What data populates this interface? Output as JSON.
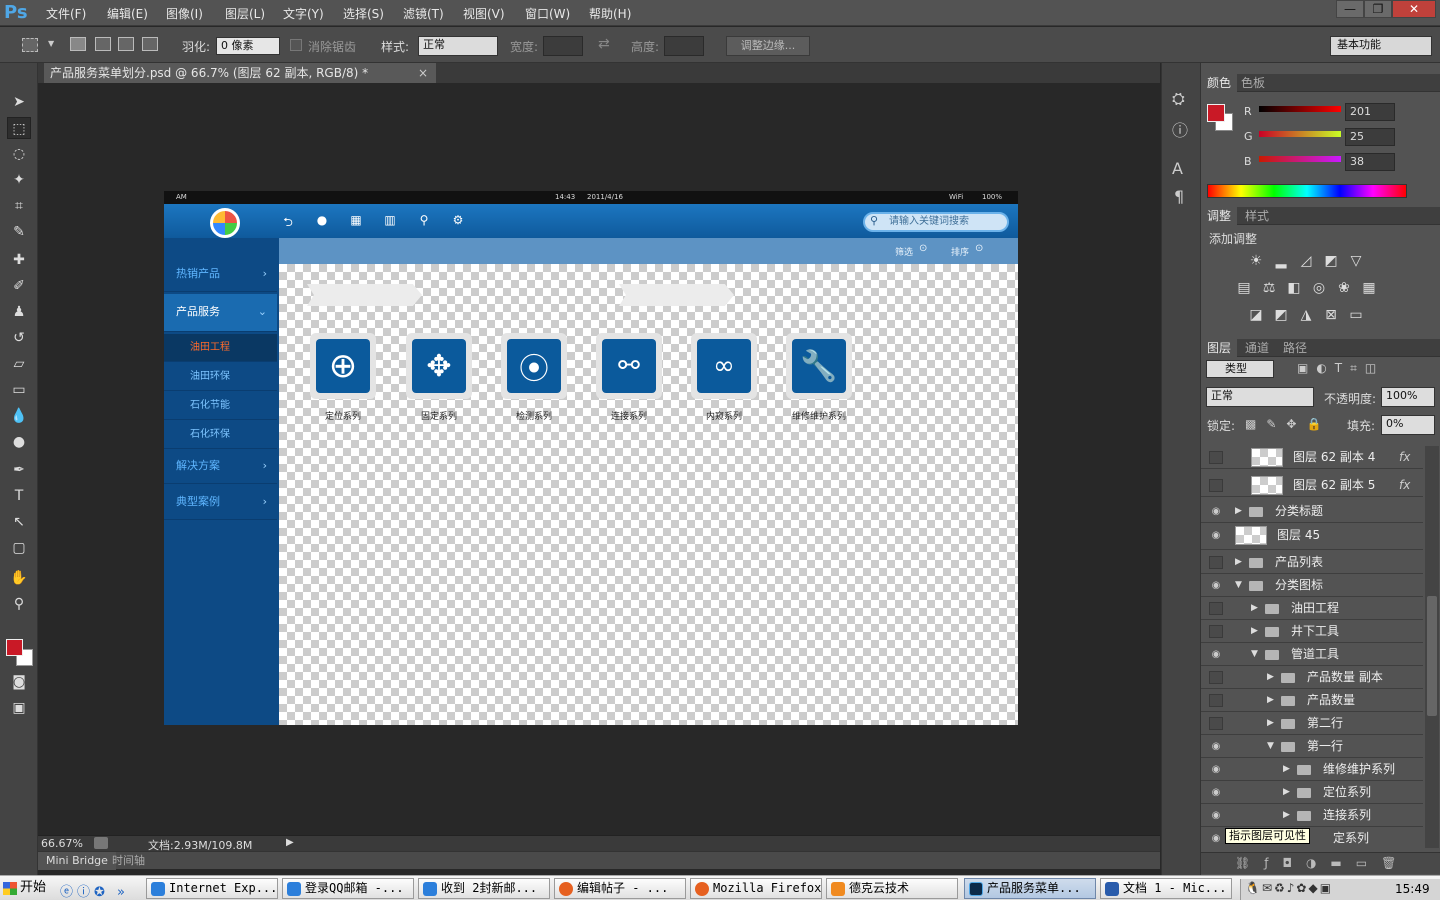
{
  "menubar": {
    "logo": "Ps",
    "items": [
      "文件(F)",
      "编辑(E)",
      "图像(I)",
      "图层(L)",
      "文字(Y)",
      "选择(S)",
      "滤镜(T)",
      "视图(V)",
      "窗口(W)",
      "帮助(H)"
    ],
    "window_buttons": [
      "—",
      "❐",
      "✕"
    ]
  },
  "options": {
    "feather_label": "羽化:",
    "feather_value": "0 像素",
    "antialias_label": "消除锯齿",
    "style_label": "样式:",
    "style_value": "正常",
    "width_label": "宽度:",
    "height_label": "高度:",
    "refine_edge": "调整边缘...",
    "workspace": "基本功能"
  },
  "document": {
    "tab_title": "产品服务菜单划分.psd @ 66.7% (图层 62 副本, RGB/8) *",
    "close": "×"
  },
  "artwork": {
    "status_left": "AM",
    "status_time": "14:43",
    "status_date": "2011/4/16",
    "status_wifi": "WiFi",
    "status_batt": "100%",
    "search_placeholder": "请输入关键词搜索",
    "filter_label": "筛选",
    "sort_label": "排序",
    "sidebar": [
      {
        "label": "热销产品"
      },
      {
        "label": "产品服务"
      },
      {
        "label": "油田工程"
      },
      {
        "label": "油田环保"
      },
      {
        "label": "石化节能"
      },
      {
        "label": "石化环保"
      },
      {
        "label": "解决方案"
      },
      {
        "label": "典型案例"
      }
    ],
    "tiles": [
      {
        "label": "定位系列"
      },
      {
        "label": "固定系列"
      },
      {
        "label": "检测系列"
      },
      {
        "label": "连接系列"
      },
      {
        "label": "内窥系列"
      },
      {
        "label": "维修维护系列"
      }
    ]
  },
  "status": {
    "zoom": "66.67%",
    "doc_info": "文档:2.93M/109.8M",
    "tab_minibridge": "Mini Bridge",
    "tab_timeline": "时间轴"
  },
  "color_panel": {
    "tab_color": "颜色",
    "tab_swatches": "色板",
    "r_label": "R",
    "g_label": "G",
    "b_label": "B",
    "r": "201",
    "g": "25",
    "b": "38",
    "foreground": "#c91926"
  },
  "adjust_panel": {
    "tab_adjust": "调整",
    "tab_style": "样式",
    "add_label": "添加调整"
  },
  "layers_panel": {
    "tab_layers": "图层",
    "tab_channels": "通道",
    "tab_paths": "路径",
    "filter_kind": "类型",
    "blend": "正常",
    "opacity_label": "不透明度:",
    "opacity": "100%",
    "lock_label": "锁定:",
    "fill_label": "填充:",
    "fill": "0%",
    "tooltip": "指示图层可见性",
    "layers": [
      {
        "name": "图层 62 副本 4",
        "fx": "fx"
      },
      {
        "name": "图层 62 副本 5",
        "fx": "fx"
      },
      {
        "name": "分类标题"
      },
      {
        "name": "图层 45"
      },
      {
        "name": "产品列表"
      },
      {
        "name": "分类图标"
      },
      {
        "name": "油田工程"
      },
      {
        "name": "井下工具"
      },
      {
        "name": "管道工具"
      },
      {
        "name": "产品数量 副本"
      },
      {
        "name": "产品数量"
      },
      {
        "name": "第二行"
      },
      {
        "name": "第一行"
      },
      {
        "name": "维修维护系列"
      },
      {
        "name": "定位系列"
      },
      {
        "name": "连接系列"
      },
      {
        "name": "定系列"
      }
    ]
  },
  "taskbar": {
    "start": "开始",
    "tasks": [
      "Internet Exp...",
      "登录QQ邮箱 -...",
      "收到 2封新邮...",
      "编辑帖子 - ...",
      "Mozilla Firefox",
      "德克云技术",
      "产品服务菜单...",
      "文档 1 - Mic..."
    ],
    "clock": "15:49"
  }
}
